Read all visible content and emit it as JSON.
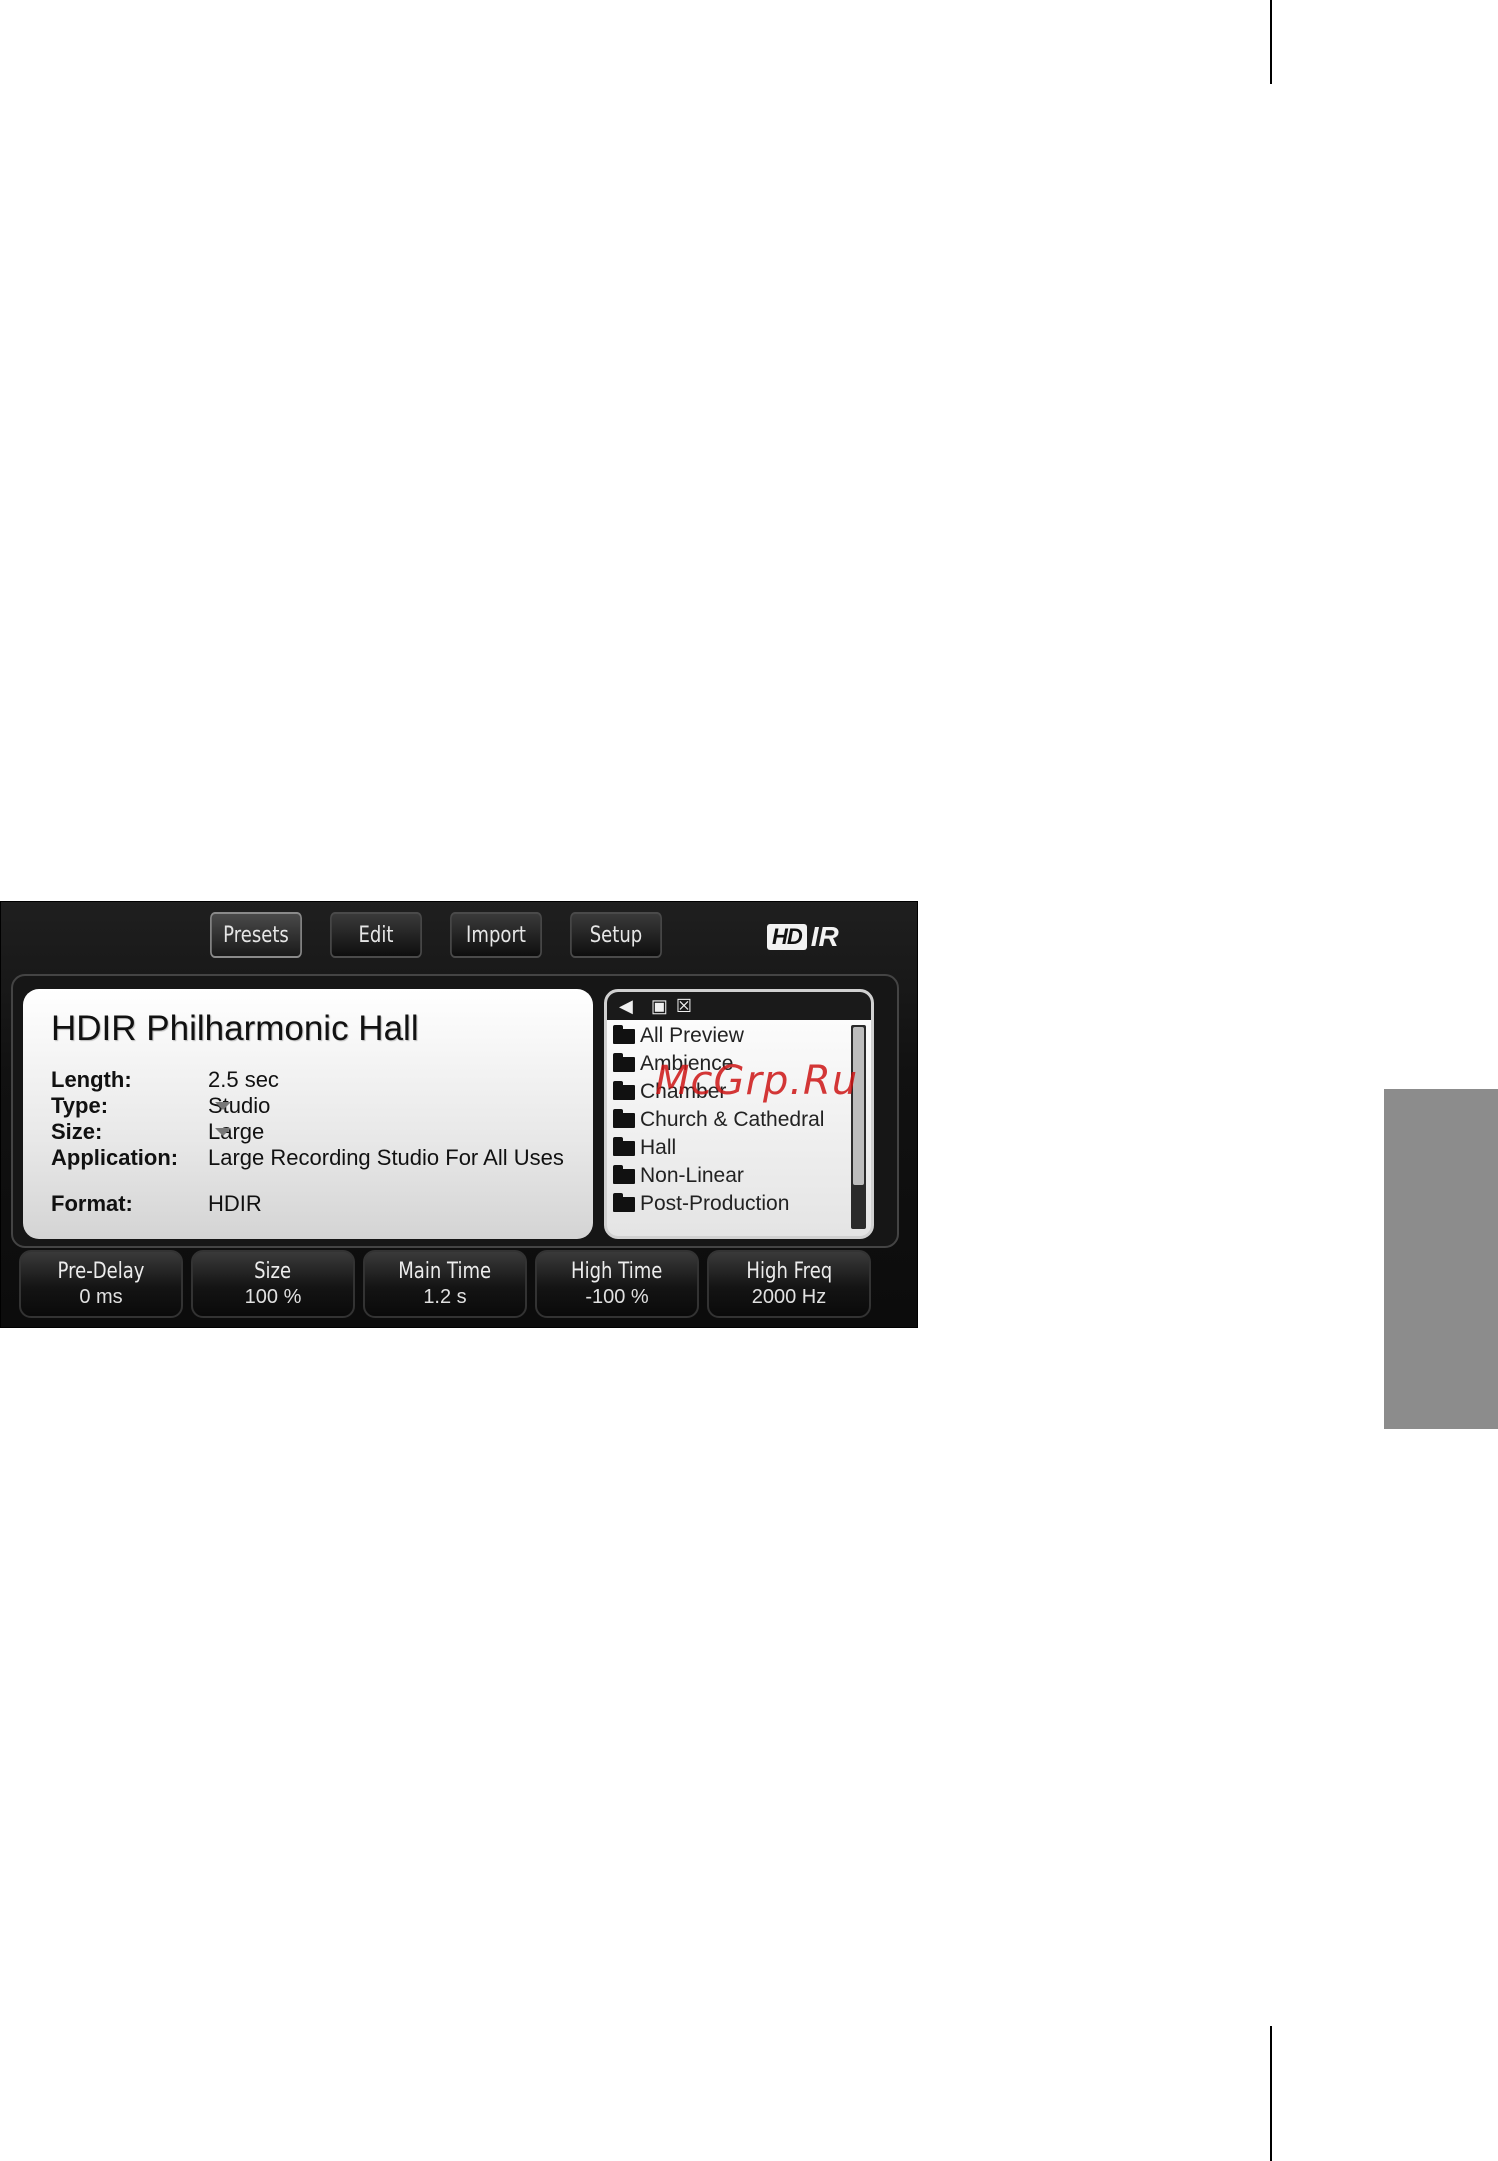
{
  "tabs": [
    "Presets",
    "Edit",
    "Import",
    "Setup"
  ],
  "active_tab": "Presets",
  "logo": {
    "hd": "HD",
    "ir": "IR"
  },
  "preset": {
    "title": "HDIR Philharmonic Hall",
    "length_label": "Length:",
    "length_value": "2.5 sec",
    "type_label": "Type:",
    "type_value": "Studio",
    "size_label": "Size:",
    "size_value": "Large",
    "application_label": "Application:",
    "application_value": "Large Recording Studio For All Uses",
    "format_label": "Format:",
    "format_value": "HDIR"
  },
  "browser": {
    "folders": [
      "All Preview",
      "Ambience",
      "Chamber",
      "Church & Cathedral",
      "Hall",
      "Non-Linear",
      "Post-Production"
    ]
  },
  "params": [
    {
      "name": "Pre-Delay",
      "value": "0 ms"
    },
    {
      "name": "Size",
      "value": "100 %"
    },
    {
      "name": "Main Time",
      "value": "1.2 s"
    },
    {
      "name": "High Time",
      "value": "-100 %"
    },
    {
      "name": "High Freq",
      "value": "2000 Hz"
    }
  ],
  "watermark": "McGrp.Ru",
  "colors": {
    "panel_bg": "#111111",
    "info_bg": "#eeeeee",
    "side_tab": "#8c8c8c",
    "watermark": "#cc1414"
  }
}
